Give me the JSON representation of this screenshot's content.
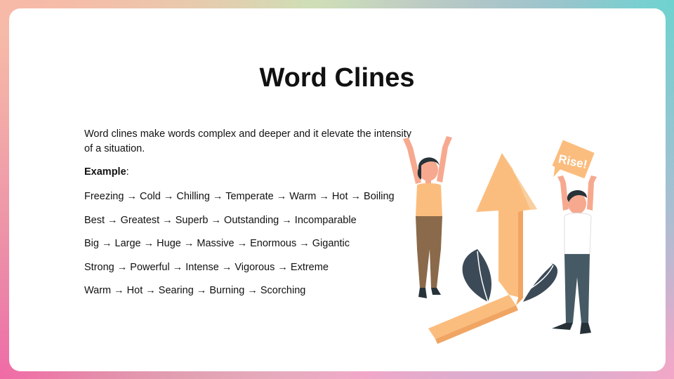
{
  "slide": {
    "title": "Word Clines",
    "intro": "Word clines make words complex and deeper and it elevate the intensity of a situation.",
    "example_label": "Example",
    "example_suffix": ":",
    "clines": [
      "Freezing → Cold → Chilling  → Temperate → Warm → Hot → Boiling",
      "Best → Greatest → Superb → Outstanding → Incomparable",
      "Big → Large → Huge → Massive → Enormous → Gigantic",
      "Strong → Powerful → Intense → Vigorous → Extreme",
      "Warm → Hot → Searing → Burning → Scorching"
    ]
  },
  "illustration": {
    "sign_text": "Rise!",
    "colors": {
      "arrow": "#fbbd7e",
      "arrow_dark": "#f0a563",
      "leaf": "#3c4a57",
      "skin": "#f6a98f",
      "hair": "#263238",
      "shirt_woman": "#fbbd7e",
      "pants_woman": "#8a6a4a",
      "shirt_man": "#ffffff",
      "pants_man": "#455a64"
    }
  }
}
